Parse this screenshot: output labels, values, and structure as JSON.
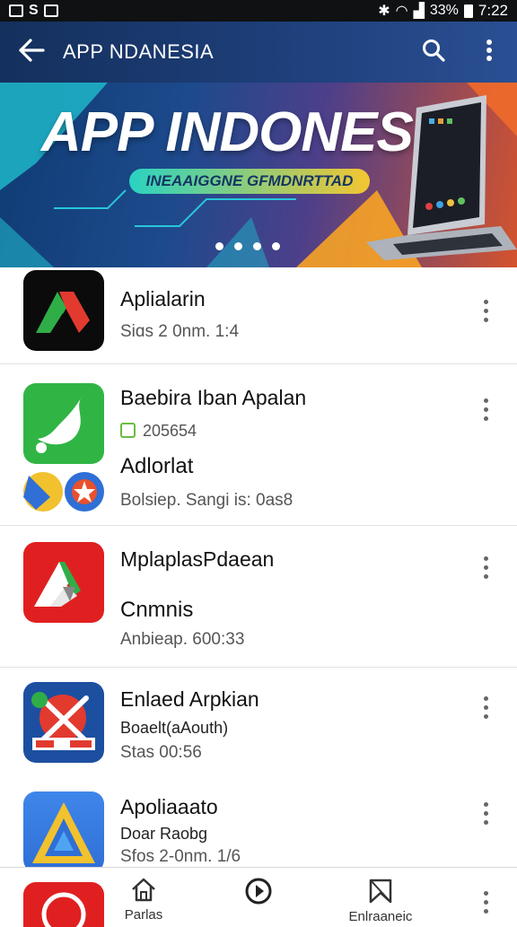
{
  "status_bar": {
    "left_icons": [
      "screenshot-icon",
      "sim-icon",
      "image-icon"
    ],
    "battery": "33%",
    "time": "7:22"
  },
  "header": {
    "title": "APP NDANESIA"
  },
  "banner": {
    "title": "APP INDONESIA",
    "subtitle": "INEAAIGGNE GFMDNRTTAD",
    "page_count": 4
  },
  "apps": [
    {
      "name": "Aplialarin",
      "meta": "Siɑs 2 0nm. 1:4"
    },
    {
      "name": "Baebira Iban Apalan",
      "badge_text": "205654",
      "subname": "Adlorlat",
      "meta": "Bolsiep. Sangi is: 0as8"
    },
    {
      "name": "MplaplasPdaean",
      "subname": "Cnmnis",
      "meta": "Anbieap. 600:33"
    },
    {
      "name": "Enlaed Arpkian",
      "sub1": "Boaelt(aAouth)",
      "meta": "Stas 00:56"
    },
    {
      "name": "Apoliaaato",
      "sub1": "Doar Raobg",
      "meta": "Sfos 2-0nm. 1/6"
    }
  ],
  "bottom_nav": [
    {
      "label": "Parlas",
      "icon": "home-icon"
    },
    {
      "label": "",
      "icon": "play-circle-icon"
    },
    {
      "label": "Enlraaneic",
      "icon": "bookmark-icon"
    }
  ],
  "colors": {
    "header_bg": "#1e3f7a",
    "green": "#30b545",
    "red": "#e02020",
    "blue": "#2f6fd6"
  }
}
